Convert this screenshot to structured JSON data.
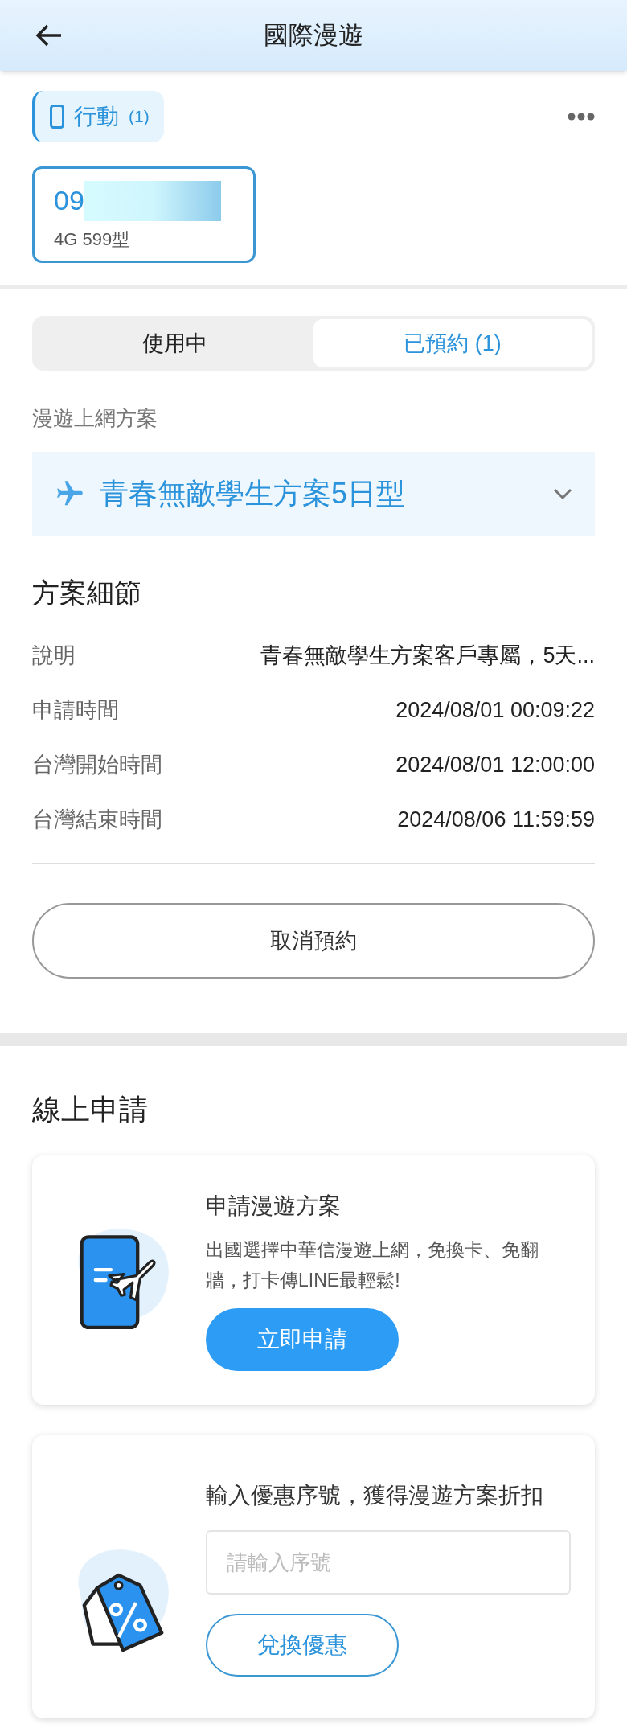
{
  "header": {
    "title": "國際漫遊"
  },
  "category": {
    "label": "行動",
    "count": "(1)"
  },
  "line_card": {
    "number": "09",
    "plan": "4G 599型",
    "selected": true
  },
  "tabs": [
    {
      "label": "使用中",
      "selected": false
    },
    {
      "label": "已預約 (1)",
      "selected": true
    }
  ],
  "plan_section": {
    "label": "漫遊上網方案",
    "plan": "青春無敵學生方案5日型"
  },
  "details": {
    "title": "方案細節",
    "rows": [
      {
        "label": "說明",
        "value": "青春無敵學生方案客戶專屬，5天..."
      },
      {
        "label": "申請時間",
        "value": "2024/08/01 00:09:22"
      },
      {
        "label": "台灣開始時間",
        "value": "2024/08/01 12:00:00"
      },
      {
        "label": "台灣結束時間",
        "value": "2024/08/06 11:59:59"
      }
    ],
    "button": "取消預約"
  },
  "online": {
    "title": "線上申請",
    "apply_card": {
      "title": "申請漫遊方案",
      "text": "出國選擇中華信漫遊上網，免換卡、免翻牆，打卡傳LINE最輕鬆!",
      "button": "立即申請"
    },
    "coupon_card": {
      "title": "輸入優惠序號，獲得漫遊方案折扣",
      "placeholder": "請輸入序號",
      "button": "兌換優惠"
    }
  }
}
